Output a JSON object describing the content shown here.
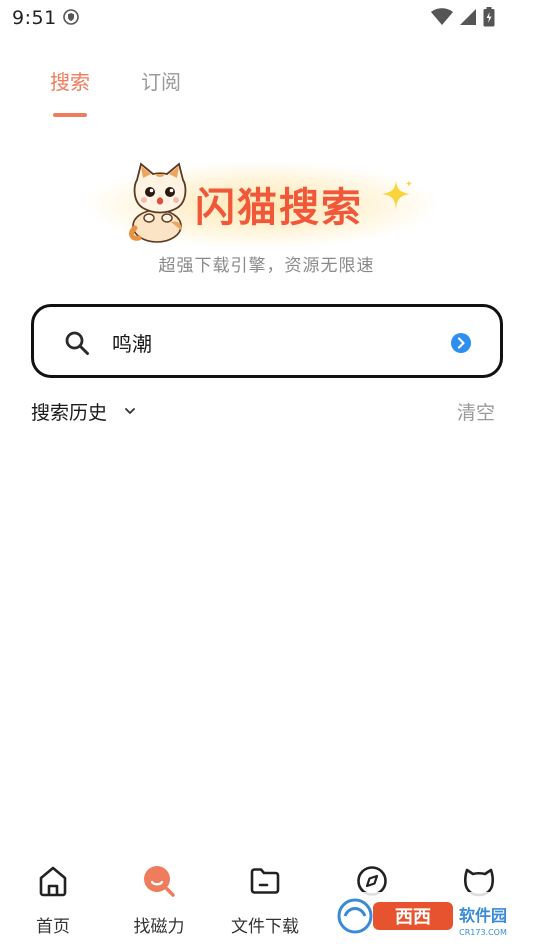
{
  "status_bar": {
    "time": "9:51",
    "icons": [
      "shield-icon",
      "wifi-icon",
      "signal-icon",
      "battery-icon"
    ]
  },
  "tabs": [
    {
      "label": "搜索",
      "active": true
    },
    {
      "label": "订阅",
      "active": false
    }
  ],
  "brand": {
    "logo_text": "闪猫搜索",
    "tagline": "超强下载引擎，资源无限速",
    "accent_color": "#f1583a"
  },
  "search": {
    "value": "鸣潮",
    "icon": "search-icon",
    "go_icon": "arrow-right-circle-icon"
  },
  "history": {
    "title": "搜索历史",
    "clear_label": "清空",
    "items": []
  },
  "bottom_nav": [
    {
      "label": "首页",
      "icon": "home-icon",
      "active": false
    },
    {
      "label": "找磁力",
      "icon": "magnet-search-icon",
      "active": true
    },
    {
      "label": "文件下载",
      "icon": "folder-icon",
      "active": false
    },
    {
      "label": "",
      "icon": "compass-icon",
      "active": false
    },
    {
      "label": "",
      "icon": "cat-icon",
      "active": false
    }
  ],
  "watermark": {
    "text": "西西软件园",
    "subtext": "CR173.COM"
  },
  "colors": {
    "accent": "#f07c5e",
    "search_go": "#2f8ff0"
  }
}
